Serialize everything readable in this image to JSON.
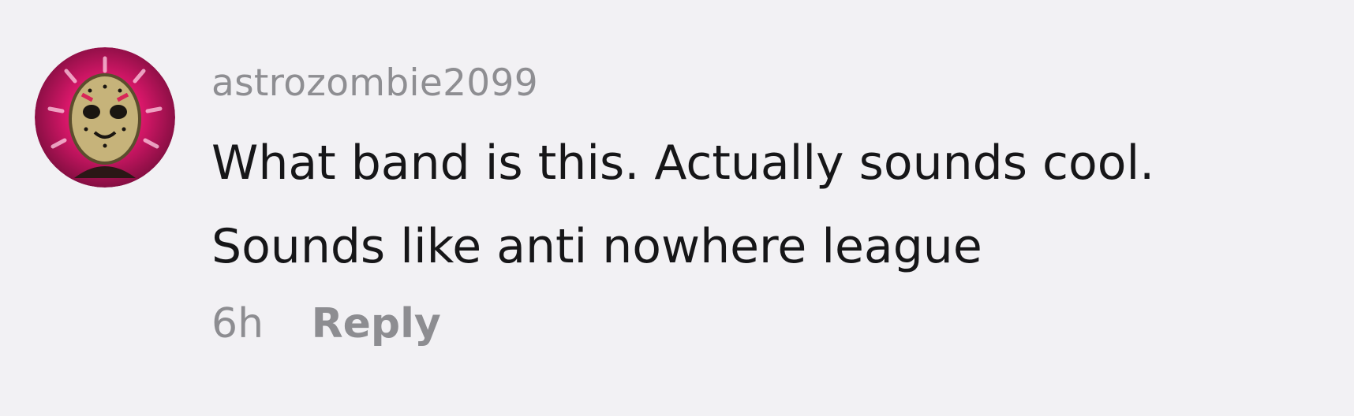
{
  "comment": {
    "avatar_icon": "hockey-mask-avatar-icon",
    "username": "astrozombie2099",
    "text_lines": [
      "What band is this. Actually sounds cool.",
      "Sounds like anti nowhere league"
    ],
    "timestamp": "6h",
    "reply_label": "Reply"
  },
  "colors": {
    "background": "#f2f1f4",
    "username": "#8e8e92",
    "text": "#161618",
    "meta": "#8d8d91",
    "avatar_ring": "#e0186d"
  }
}
